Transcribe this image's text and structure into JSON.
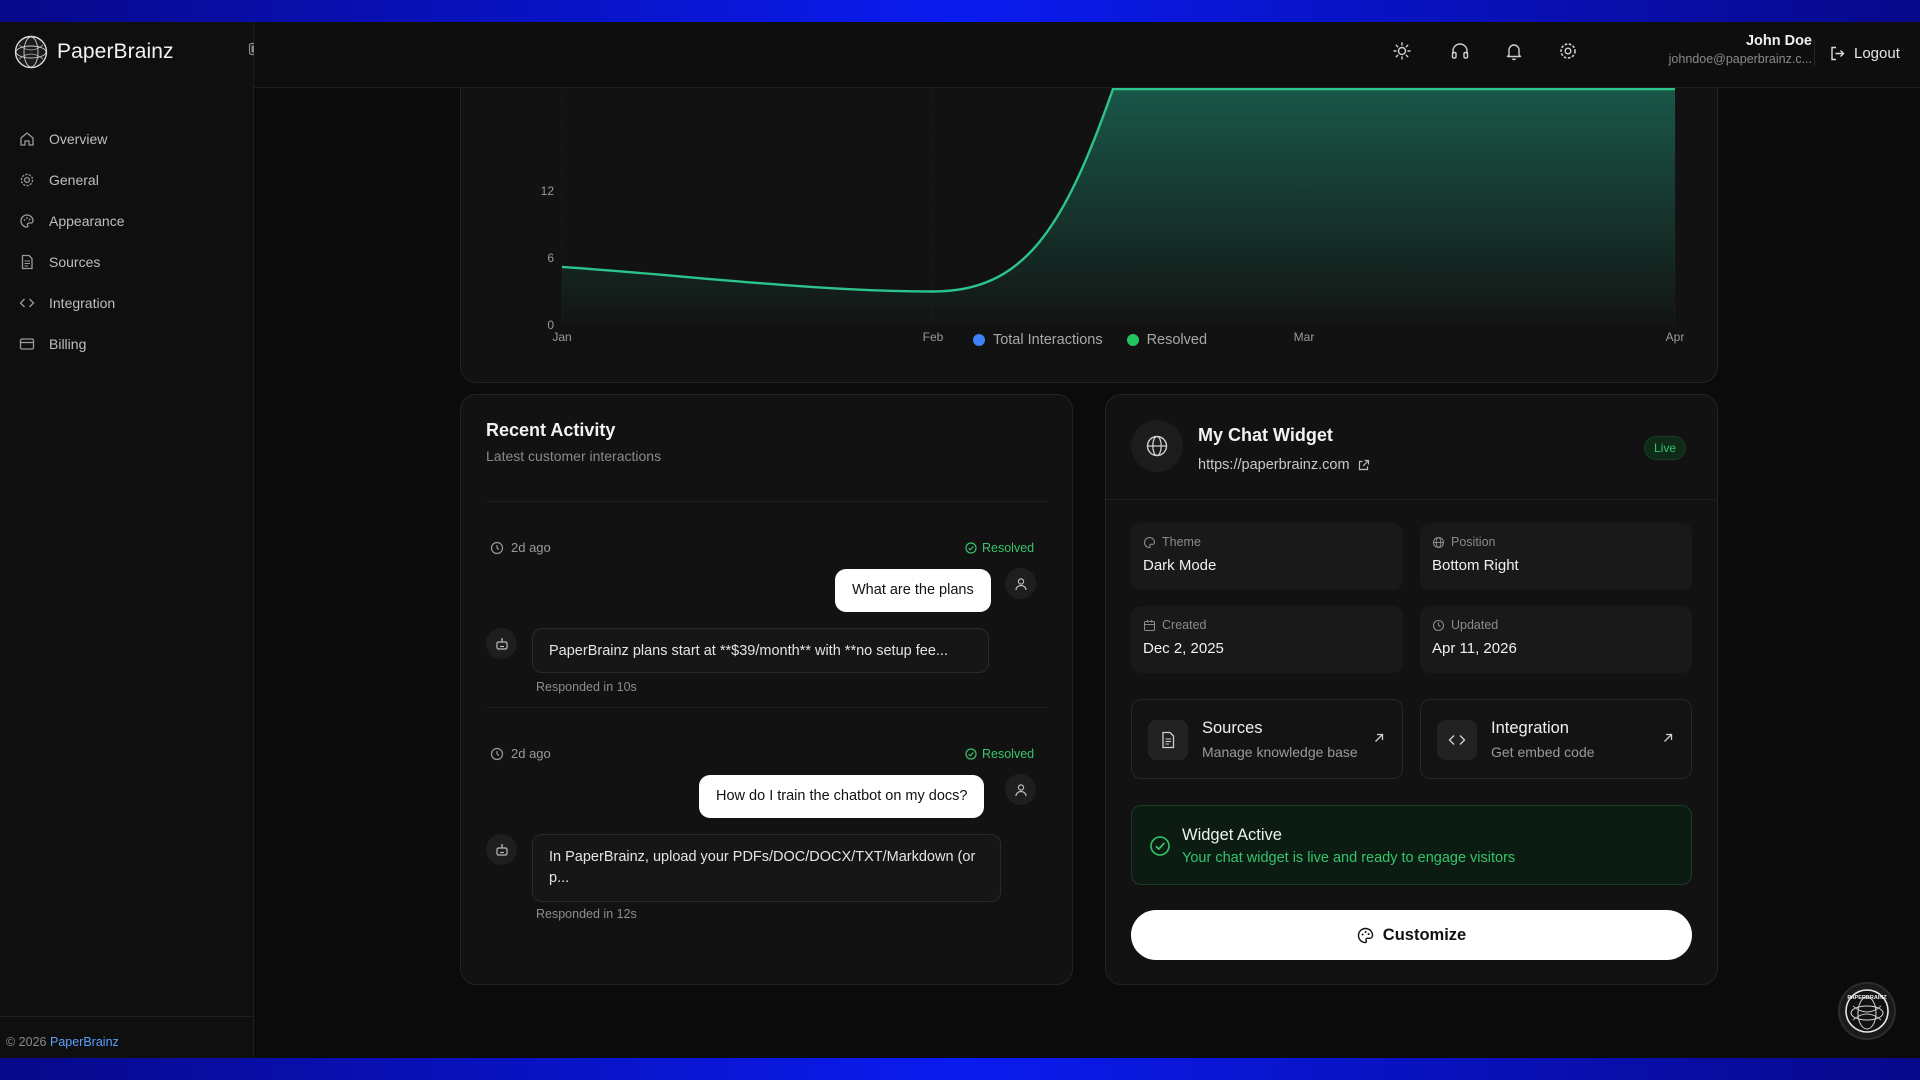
{
  "app": {
    "name": "PaperBrainz"
  },
  "sidebar": {
    "items": [
      {
        "label": "Overview",
        "icon": "home-icon"
      },
      {
        "label": "General",
        "icon": "gear-icon"
      },
      {
        "label": "Appearance",
        "icon": "palette-icon"
      },
      {
        "label": "Sources",
        "icon": "document-icon"
      },
      {
        "label": "Integration",
        "icon": "code-icon"
      },
      {
        "label": "Billing",
        "icon": "credit-card-icon"
      }
    ],
    "footer": {
      "copyright": "© 2026",
      "link": "PaperBrainz"
    }
  },
  "header": {
    "user": {
      "name": "John Doe",
      "email": "johndoe@paperbrainz.c..."
    },
    "logout_label": "Logout"
  },
  "chart_data": {
    "type": "area",
    "x": [
      "Jan",
      "Feb",
      "Mar",
      "Apr"
    ],
    "yticks": [
      0,
      6,
      12
    ],
    "series": [
      {
        "name": "Total Interactions",
        "color": "#3b82f6"
      },
      {
        "name": "Resolved",
        "color": "#22c55e",
        "values": [
          5.2,
          3,
          20,
          20
        ]
      }
    ]
  },
  "activity": {
    "title": "Recent Activity",
    "subtitle": "Latest customer interactions",
    "items": [
      {
        "time": "2d ago",
        "status": "Resolved",
        "question": "What are the plans",
        "answer": "PaperBrainz plans start at **$39/month** with **no setup fee...",
        "responded": "Responded in 10s"
      },
      {
        "time": "2d ago",
        "status": "Resolved",
        "question": "How do I train the chatbot on my docs?",
        "answer_line1": "In PaperBrainz, upload your PDFs/DOC/DOCX/TXT/Markdown (or",
        "answer_line2": "p...",
        "responded": "Responded in 12s"
      }
    ]
  },
  "widget": {
    "name": "My Chat Widget",
    "url": "https://paperbrainz.com",
    "status": "Live",
    "theme": {
      "label": "Theme",
      "value": "Dark Mode"
    },
    "position": {
      "label": "Position",
      "value": "Bottom Right"
    },
    "created": {
      "label": "Created",
      "value": "Dec 2, 2025"
    },
    "updated": {
      "label": "Updated",
      "value": "Apr 11, 2026"
    },
    "sources": {
      "title": "Sources",
      "subtitle": "Manage knowledge base"
    },
    "integration": {
      "title": "Integration",
      "subtitle": "Get embed code"
    },
    "active": {
      "title": "Widget Active",
      "subtitle": "Your chat widget is live and ready to engage visitors"
    },
    "customize_label": "Customize"
  }
}
